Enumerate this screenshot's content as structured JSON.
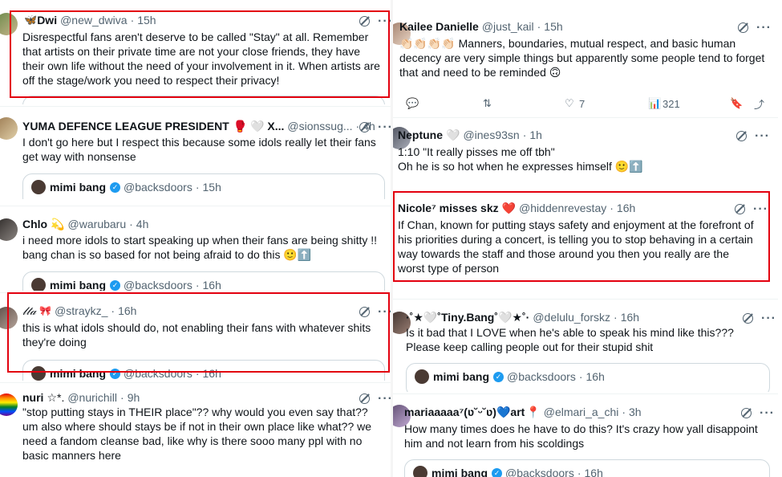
{
  "left": [
    {
      "display_name": "Dwi",
      "prefix_emoji": "🦋",
      "handle": "@new_dwiva",
      "time": "15h",
      "body": "Disrespectful fans aren't deserve to be called \"Stay\" at all. Remember that artists on their private time are not your close friends, they have their own life without the need of your involvement in it. When artists are off the stage/work you need to respect their privacy!",
      "quote": null
    },
    {
      "display_name": "YUMA DEFENCE LEAGUE PRESIDENT",
      "suffix_emoji": "🥊 🤍 X...",
      "handle": "@sionssug...",
      "time": "4h",
      "body": "I don't go here but I respect this because some idols really let their fans get way with nonsense",
      "quote": {
        "name": "mimi bang",
        "handle": "@backsdoors",
        "time": "15h"
      }
    },
    {
      "display_name": "Chlo",
      "suffix_emoji": "💫",
      "handle": "@warubaru",
      "time": "4h",
      "body": "i need more idols to start speaking up when their fans are being shitty !! bang chan is so based for not being afraid to do this 🙂⬆️",
      "quote": {
        "name": "mimi bang",
        "handle": "@backsdoors",
        "time": "16h"
      }
    },
    {
      "display_name": "𝓁𝓉𝒶",
      "suffix_emoji": "🎀",
      "handle": "@straykz_",
      "time": "16h",
      "body": "this is what idols should do, not enabling their fans with whatever shits they're doing",
      "quote": {
        "name": "mimi bang",
        "handle": "@backsdoors",
        "time": "16h"
      }
    },
    {
      "display_name": "nuri",
      "suffix_emoji": "☆*.",
      "handle": "@nurichill",
      "time": "9h",
      "body": "\"stop putting stays in THEIR place\"?? why would you even say that?? um also where should stays be if not in their own place like what?? we need a fandom cleanse bad, like why is there sooo many ppl with no basic manners here",
      "quote": null
    }
  ],
  "right": [
    {
      "display_name": "Kailee Danielle",
      "handle": "@just_kail",
      "time": "15h",
      "body": "👏🏻👏🏻👏🏻👏🏻 Manners, boundaries, mutual respect, and basic human decency are very simple things but apparently some people tend to forget that and need to be reminded 🙃",
      "actions": {
        "likes": "7",
        "views": "321"
      }
    },
    {
      "display_name": "Neptune",
      "suffix_emoji": "🤍",
      "handle": "@ines93sn",
      "time": "1h",
      "body": "1:10 \"It really pisses me off tbh\"\nOh he is so hot when he expresses himself 🙂⬆️",
      "quote": null
    },
    {
      "display_name": "Nicole⁷ misses skz",
      "suffix_emoji": "❤️",
      "handle": "@hiddenrevestay",
      "time": "16h",
      "body": "If Chan, known for putting stays safety and enjoyment at the forefront of his priorities during a concert, is telling you to stop behaving in a certain way towards the staff and those around you then you really are the worst type of person",
      "quote": null
    },
    {
      "display_name": "·˚★🤍˚Tiny.Bang˚🤍★˚·",
      "handle": "@delulu_forskz",
      "time": "16h",
      "body": "Is it bad that I LOVE when he's able to speak his mind like this??? Please keep calling people out for their stupid shit",
      "quote": {
        "name": "mimi bang",
        "handle": "@backsdoors",
        "time": "16h"
      }
    },
    {
      "display_name": "mariaaaaa⁷(ʋ˘ᵕ˘ʋ)💙art",
      "suffix_emoji": "📍",
      "handle": "@elmari_a_chi",
      "time": "3h",
      "body": "How many times does he have to do this? It's crazy how yall disappoint him and not learn from his scoldings",
      "quote": {
        "name": "mimi bang",
        "handle": "@backsdoors",
        "time": "16h"
      }
    }
  ],
  "icons": {
    "grok": "grok-icon",
    "more": "more-icon",
    "verified": "verified-badge-icon"
  },
  "more_glyph": "···",
  "highlight_color": "#e3000f"
}
